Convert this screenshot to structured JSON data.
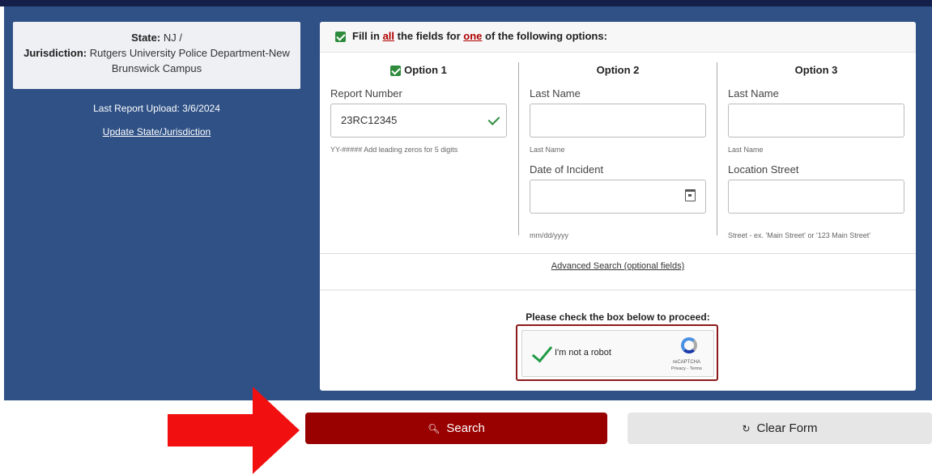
{
  "jurisdiction_card": {
    "state_label": "State:",
    "state_value": "NJ  /",
    "jurisdiction_label": "Jurisdiction:",
    "jurisdiction_value": "Rutgers University Police Department-New Brunswick Campus"
  },
  "last_upload": "Last Report Upload: 3/6/2024",
  "update_link": "Update State/Jurisdiction",
  "form": {
    "header_pre": "Fill in ",
    "header_all": "all",
    "header_mid": " the fields for ",
    "header_one": "one",
    "header_post": " of the following options:",
    "option1": {
      "title": "Option 1",
      "report_label": "Report Number",
      "report_value": "23RC12345",
      "report_help": "YY-##### Add leading zeros for 5 digits"
    },
    "option2": {
      "title": "Option 2",
      "lastname_label": "Last Name",
      "lastname_help": "Last Name",
      "date_label": "Date of Incident",
      "date_help": "mm/dd/yyyy"
    },
    "option3": {
      "title": "Option 3",
      "lastname_label": "Last Name",
      "lastname_help": "Last Name",
      "street_label": "Location Street",
      "street_help": "Street - ex. 'Main Street' or '123 Main Street'"
    },
    "advanced_link": "Advanced Search (optional fields)",
    "proceed_text": "Please check the box below to proceed:",
    "captcha": {
      "label": "I'm not a robot",
      "brand": "reCAPTCHA",
      "links": "Privacy - Terms"
    }
  },
  "buttons": {
    "search_label": "Search",
    "search_icon": "document-search-icon",
    "clear_label": "Clear Form",
    "clear_icon": "refresh-icon"
  },
  "colors": {
    "panel_blue": "#2f5186",
    "search_red": "#990000",
    "arrow_red": "#f20f0f",
    "check_green": "#2e8b3c"
  }
}
